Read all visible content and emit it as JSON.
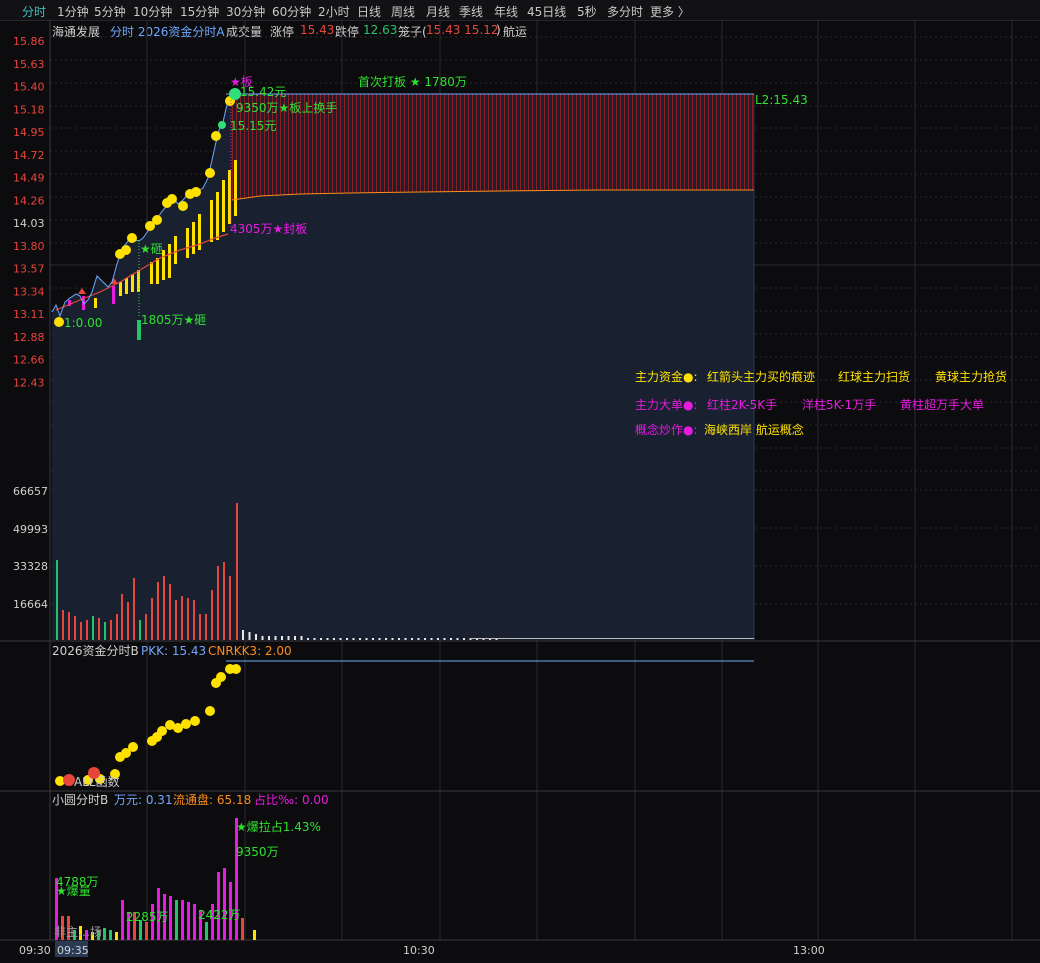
{
  "tabs": [
    "分时",
    "1分钟",
    "5分钟",
    "10分钟",
    "15分钟",
    "30分钟",
    "60分钟",
    "2小时",
    "日线",
    "周线",
    "月线",
    "季线",
    "年线",
    "45日线",
    "5秒",
    "多分时",
    "更多 〉"
  ],
  "title": {
    "stock": "海通发展",
    "indicator": "分时 2026资金分时A",
    "volume_label": "成交量",
    "up_limit_label": "涨停",
    "up_limit_value": "15.43",
    "down_limit_label": "跌停",
    "down_limit_value": "12.63",
    "cage_label": "笼子(",
    "cage_values": "15.43 15.12",
    "cage_close": ")",
    "concept": "航运"
  },
  "price_axis": [
    "15.86",
    "15.63",
    "15.40",
    "15.18",
    "14.95",
    "14.72",
    "14.49",
    "14.26",
    "14.03",
    "13.80",
    "13.57",
    "13.34",
    "13.11",
    "12.88",
    "12.66",
    "12.43"
  ],
  "volume_axis": [
    "66657",
    "49993",
    "33328",
    "16664"
  ],
  "annotations": {
    "board": "★板",
    "price_15_42": "15.42元",
    "huanshou": "9350万★板上换手",
    "price_15_15": "15.15元",
    "fengban": "4305万★封板",
    "first_board": "首次打板 ★ 1780万",
    "l2": "L2:15.43",
    "start": "1:0.00",
    "ya1": "★砸",
    "ya2": "1805万★砸",
    "feng_marker": "封"
  },
  "legend": {
    "row1": [
      "主力资金●:",
      "红箭头主力买的痕迹",
      "红球主力扫货",
      "黄球主力抢货"
    ],
    "row2": [
      "主力大单●:",
      "红柱2K-5K手",
      "洋柱5K-1万手",
      "黄柱超万手大单"
    ],
    "row3": [
      "概念炒作●:",
      "海峡西岸 航运概念"
    ]
  },
  "panel2": {
    "name": "2026资金分时B",
    "pkk": "PKK: 15.43",
    "cnrkk": "CNRKK3: 2.00",
    "bottom_label": "ALL函数"
  },
  "panel3": {
    "name": "小圆分时B",
    "wan": "万元: 0.31",
    "float": "流通盘: 65.18",
    "ratio": "占比‰: 0.00",
    "baola": "★爆拉占1.43%",
    "v9350": "9350万",
    "v4788": "4788万",
    "baoliang": "★爆量",
    "v2285": "2285万",
    "v2422": "2422万",
    "bottom_text": "非主…场"
  },
  "time_axis": [
    "09:30",
    "09:35",
    "10:30",
    "13:00"
  ],
  "colors": {
    "price_line": "#6fa8ff",
    "avg_line": "#ff8c1a",
    "up": "#e8453c",
    "down": "#27c36b",
    "yellow": "#ffe100",
    "magenta": "#e81ce0",
    "green_text": "#2fe02f",
    "fill": "#1a2333"
  }
}
